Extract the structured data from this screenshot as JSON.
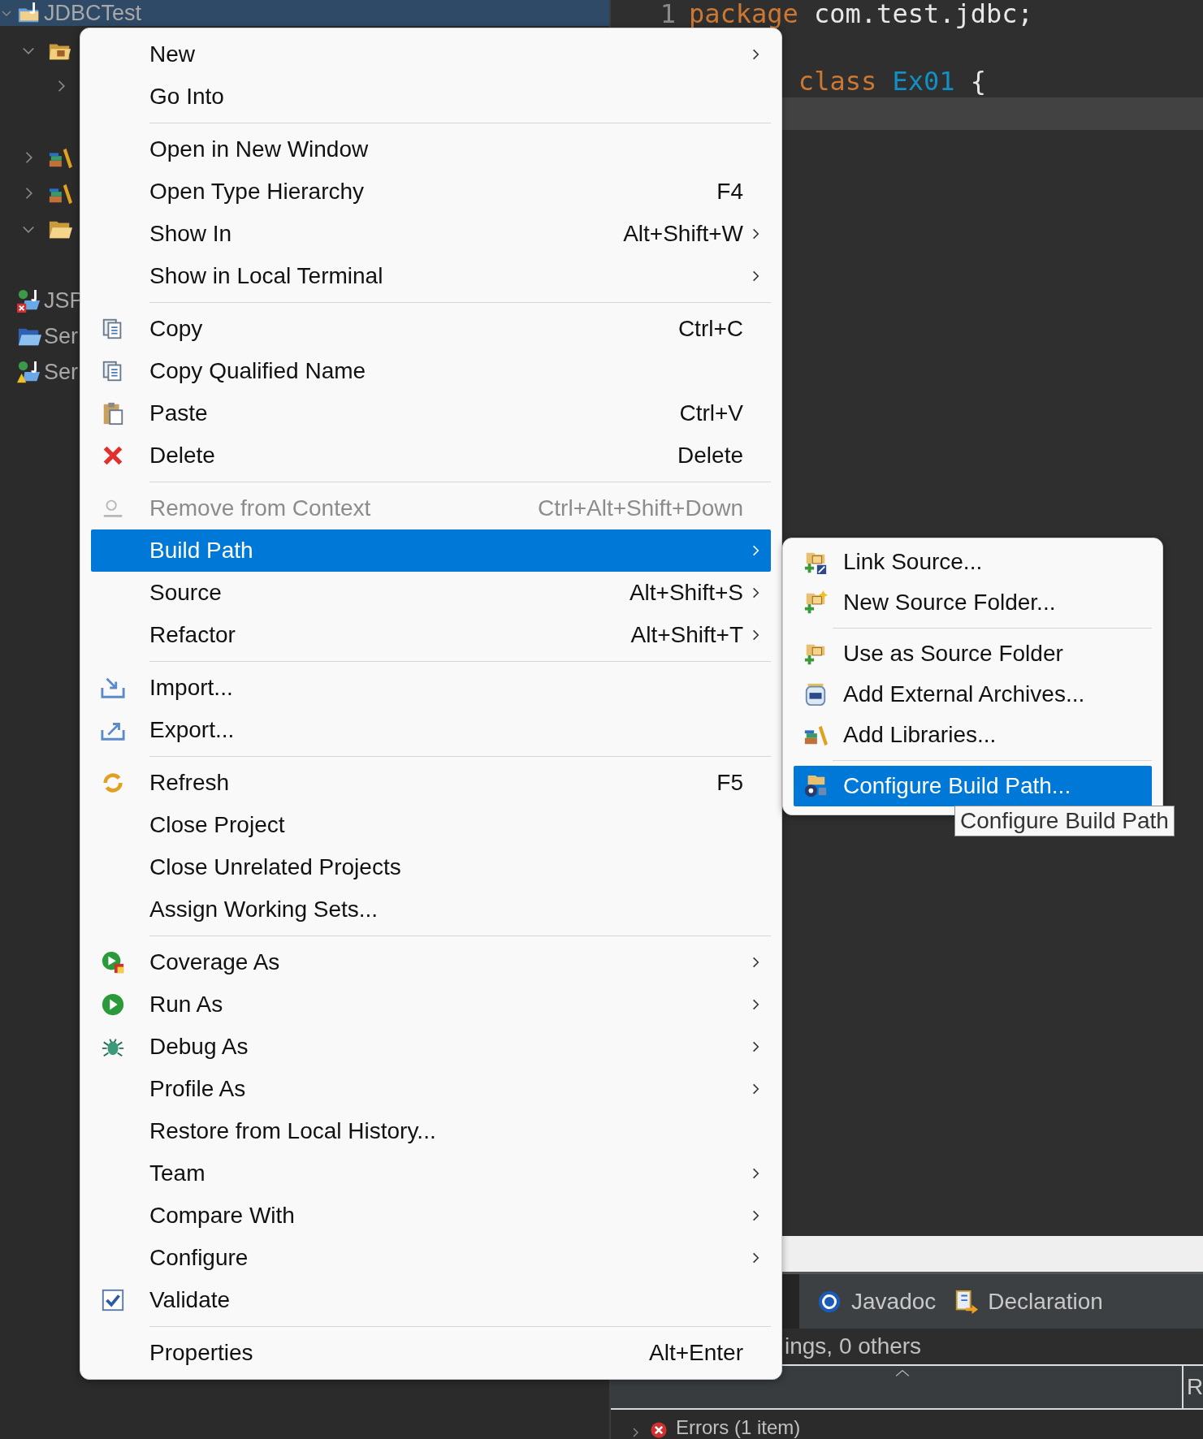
{
  "explorer": {
    "tree": [
      {
        "label": "JDBCTest",
        "kind": "project",
        "selected": true,
        "expanded": true,
        "children": [
          {
            "kind": "package-folder",
            "selected": false,
            "expanded": true,
            "children": [
              {
                "selected": false,
                "expanded": false
              },
              {
                "selected": false
              }
            ]
          },
          {
            "kind": "library",
            "selected": false,
            "expanded": false
          },
          {
            "kind": "library",
            "selected": false,
            "expanded": false
          },
          {
            "kind": "folder",
            "selected": false,
            "expanded": true,
            "children": [
              {
                "selected": false
              }
            ]
          }
        ]
      },
      {
        "label": "JSP",
        "kind": "web-project-error",
        "selected": false
      },
      {
        "label": "Ser",
        "kind": "folder-blue",
        "selected": false
      },
      {
        "label": "Ser",
        "kind": "web-project-warning",
        "selected": false
      }
    ]
  },
  "editor": {
    "lines": [
      {
        "number": "1",
        "current": false,
        "tokens": [
          {
            "text": "package",
            "kind": "keyword"
          },
          {
            "text": "com.test.jdbc;",
            "kind": "plain"
          }
        ]
      },
      {
        "current": false
      },
      {
        "current": false,
        "tokens": [
          {
            "text": "class",
            "kind": "keyword"
          },
          {
            "text": "Ex01",
            "kind": "type"
          },
          {
            "text": "{",
            "kind": "plain"
          }
        ]
      },
      {
        "current": true
      }
    ]
  },
  "bottom_panel": {
    "tabs": [
      {
        "label": "Javadoc",
        "kind": "javadoc",
        "selected": false
      },
      {
        "label": "Declaration",
        "kind": "declaration",
        "selected": false
      }
    ],
    "summary": "ings, 0 others",
    "column_2": "R",
    "rows": [
      {
        "label": "Errors (1 item)",
        "kind": "error",
        "expanded": false
      }
    ]
  },
  "context_menu": {
    "groups": [
      [
        {
          "label": "New",
          "submenu": true,
          "disabled": false,
          "selected": false
        },
        {
          "label": "Go Into",
          "submenu": false,
          "disabled": false,
          "selected": false
        }
      ],
      [
        {
          "label": "Open in New Window",
          "submenu": false,
          "disabled": false,
          "selected": false
        },
        {
          "label": "Open Type Hierarchy",
          "shortcut": "F4",
          "submenu": false,
          "disabled": false,
          "selected": false
        },
        {
          "label": "Show In",
          "shortcut": "Alt+Shift+W",
          "submenu": true,
          "disabled": false,
          "selected": false
        },
        {
          "label": "Show in Local Terminal",
          "submenu": true,
          "disabled": false,
          "selected": false
        }
      ],
      [
        {
          "label": "Copy",
          "kind": "copy",
          "shortcut": "Ctrl+C",
          "submenu": false,
          "disabled": false,
          "selected": false
        },
        {
          "label": "Copy Qualified Name",
          "kind": "copy-qualified",
          "submenu": false,
          "disabled": false,
          "selected": false
        },
        {
          "label": "Paste",
          "kind": "paste",
          "shortcut": "Ctrl+V",
          "submenu": false,
          "disabled": false,
          "selected": false
        },
        {
          "label": "Delete",
          "kind": "delete",
          "shortcut": "Delete",
          "submenu": false,
          "disabled": false,
          "selected": false
        }
      ],
      [
        {
          "label": "Remove from Context",
          "kind": "remove-context",
          "shortcut": "Ctrl+Alt+Shift+Down",
          "submenu": false,
          "disabled": true,
          "selected": false
        },
        {
          "label": "Build Path",
          "submenu": true,
          "disabled": false,
          "selected": true
        },
        {
          "label": "Source",
          "shortcut": "Alt+Shift+S",
          "submenu": true,
          "disabled": false,
          "selected": false
        },
        {
          "label": "Refactor",
          "shortcut": "Alt+Shift+T",
          "submenu": true,
          "disabled": false,
          "selected": false
        }
      ],
      [
        {
          "label": "Import...",
          "kind": "import",
          "submenu": false,
          "disabled": false,
          "selected": false
        },
        {
          "label": "Export...",
          "kind": "export",
          "submenu": false,
          "disabled": false,
          "selected": false
        }
      ],
      [
        {
          "label": "Refresh",
          "kind": "refresh",
          "shortcut": "F5",
          "submenu": false,
          "disabled": false,
          "selected": false
        },
        {
          "label": "Close Project",
          "submenu": false,
          "disabled": false,
          "selected": false
        },
        {
          "label": "Close Unrelated Projects",
          "submenu": false,
          "disabled": false,
          "selected": false
        },
        {
          "label": "Assign Working Sets...",
          "submenu": false,
          "disabled": false,
          "selected": false
        }
      ],
      [
        {
          "label": "Coverage As",
          "kind": "coverage",
          "submenu": true,
          "disabled": false,
          "selected": false
        },
        {
          "label": "Run As",
          "kind": "run",
          "submenu": true,
          "disabled": false,
          "selected": false
        },
        {
          "label": "Debug As",
          "kind": "debug",
          "submenu": true,
          "disabled": false,
          "selected": false
        },
        {
          "label": "Profile As",
          "submenu": true,
          "disabled": false,
          "selected": false
        },
        {
          "label": "Restore from Local History...",
          "submenu": false,
          "disabled": false,
          "selected": false
        },
        {
          "label": "Team",
          "submenu": true,
          "disabled": false,
          "selected": false
        },
        {
          "label": "Compare With",
          "submenu": true,
          "disabled": false,
          "selected": false
        },
        {
          "label": "Configure",
          "submenu": true,
          "disabled": false,
          "selected": false
        },
        {
          "label": "Validate",
          "kind": "checkbox",
          "checked": true,
          "submenu": false,
          "disabled": false,
          "selected": false
        }
      ],
      [
        {
          "label": "Properties",
          "shortcut": "Alt+Enter",
          "submenu": false,
          "disabled": false,
          "selected": false
        }
      ]
    ]
  },
  "build_path_submenu": {
    "groups": [
      [
        {
          "label": "Link Source...",
          "kind": "link-source",
          "selected": false
        },
        {
          "label": "New Source Folder...",
          "kind": "new-source-folder",
          "selected": false
        }
      ],
      [
        {
          "label": "Use as Source Folder",
          "kind": "use-source-folder",
          "selected": false
        },
        {
          "label": "Add External Archives...",
          "kind": "archive",
          "selected": false
        },
        {
          "label": "Add Libraries...",
          "kind": "library",
          "selected": false
        }
      ],
      [
        {
          "label": "Configure Build Path...",
          "kind": "configure",
          "selected": true
        }
      ]
    ]
  },
  "tooltip": {
    "text": "Configure Build Path"
  }
}
